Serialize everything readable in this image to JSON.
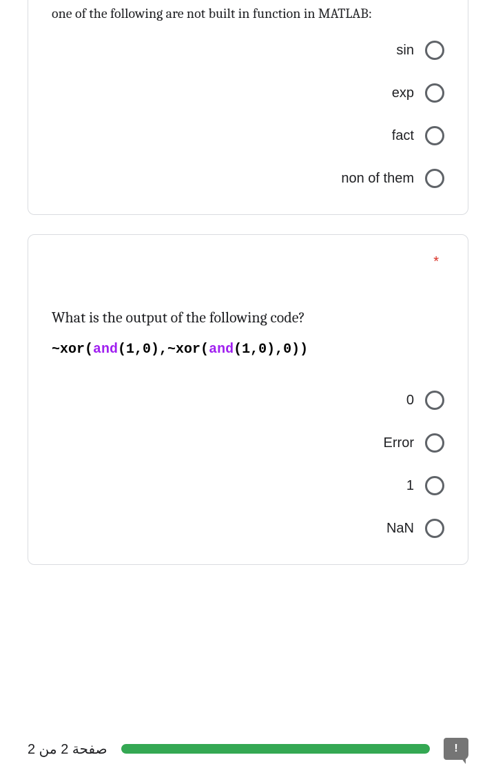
{
  "q1": {
    "title": "one of the following are not built in function in MATLAB:",
    "options": [
      "sin",
      "exp",
      "fact",
      "non of them"
    ]
  },
  "q2": {
    "required": "*",
    "title": "What is the output of the following code?",
    "code": {
      "p1": "~xor(",
      "p2": "and",
      "p3": "(1,0),~xor(",
      "p4": "and",
      "p5": "(1,0),0))"
    },
    "options": [
      "0",
      "Error",
      "1",
      "NaN"
    ]
  },
  "footer": {
    "page_label": "صفحة 2 من 2",
    "report": "!"
  }
}
